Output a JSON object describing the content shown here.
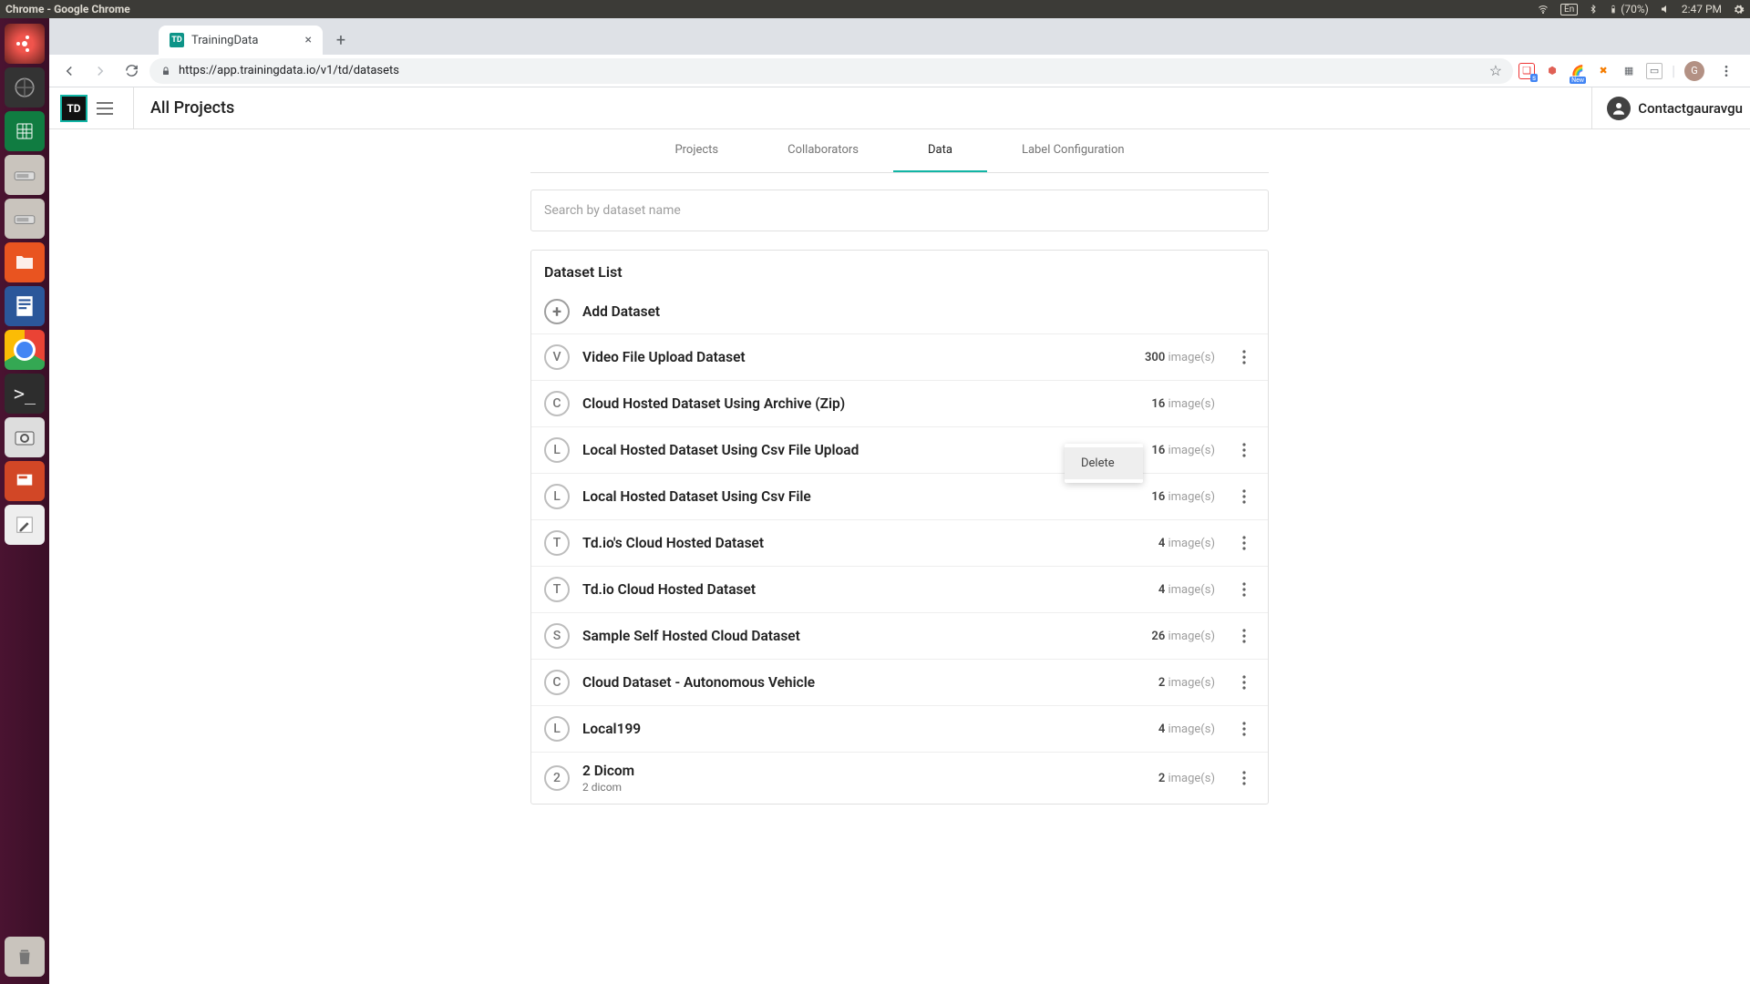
{
  "os": {
    "window_title": "Chrome - Google Chrome",
    "lang": "En",
    "battery": "(70%)",
    "clock": "2:47 PM"
  },
  "browser": {
    "tab_title": "TrainingData",
    "url": "https://app.trainingdata.io/v1/td/datasets",
    "avatar_letter": "G"
  },
  "app": {
    "logo_text": "TD",
    "header_title": "All Projects",
    "user_display": "Contactgauravgu",
    "tabs": {
      "projects": "Projects",
      "collaborators": "Collaborators",
      "data": "Data",
      "label_config": "Label Configuration"
    },
    "search_placeholder": "Search by dataset name",
    "list_title": "Dataset List",
    "add_label": "Add Dataset",
    "image_suffix": " image(s)",
    "context_menu": {
      "delete": "Delete"
    },
    "datasets": [
      {
        "initial": "V",
        "name": "Video File Upload Dataset",
        "count": "300",
        "sub": ""
      },
      {
        "initial": "C",
        "name": "Cloud Hosted Dataset Using Archive (Zip)",
        "count": "16",
        "sub": ""
      },
      {
        "initial": "L",
        "name": "Local Hosted Dataset Using Csv File Upload",
        "count": "16",
        "sub": ""
      },
      {
        "initial": "L",
        "name": "Local Hosted Dataset Using Csv File",
        "count": "16",
        "sub": ""
      },
      {
        "initial": "T",
        "name": "Td.io's Cloud Hosted Dataset",
        "count": "4",
        "sub": ""
      },
      {
        "initial": "T",
        "name": "Td.io Cloud Hosted Dataset",
        "count": "4",
        "sub": ""
      },
      {
        "initial": "S",
        "name": "Sample Self Hosted Cloud Dataset",
        "count": "26",
        "sub": ""
      },
      {
        "initial": "C",
        "name": "Cloud Dataset - Autonomous Vehicle",
        "count": "2",
        "sub": ""
      },
      {
        "initial": "L",
        "name": "Local199",
        "count": "4",
        "sub": ""
      },
      {
        "initial": "2",
        "name": "2 Dicom",
        "count": "2",
        "sub": "2 dicom"
      }
    ]
  }
}
